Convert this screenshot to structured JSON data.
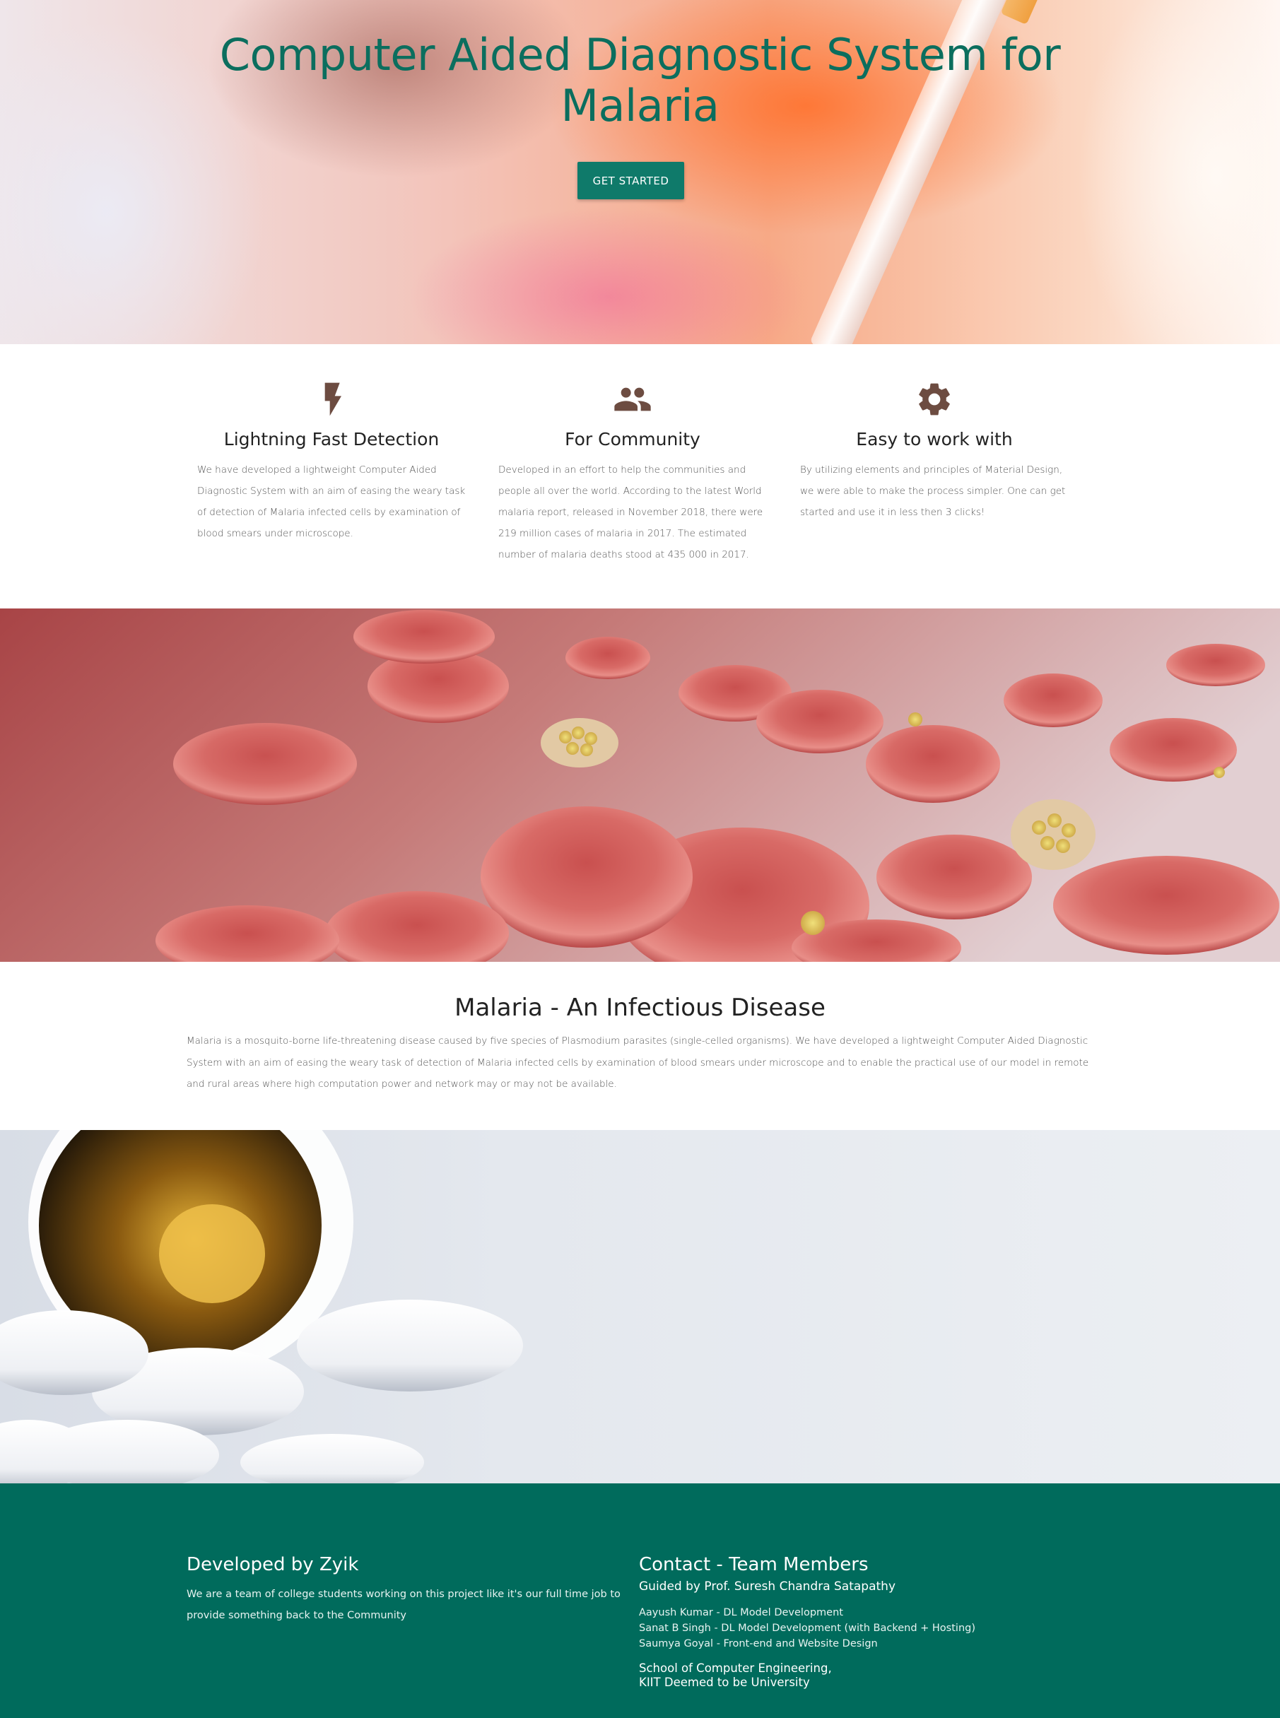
{
  "hero": {
    "title": "Computer Aided Diagnostic System for Malaria",
    "cta_label": "GET STARTED"
  },
  "features": [
    {
      "icon": "lightning-bolt-icon",
      "title": "Lightning Fast Detection",
      "text": "We have developed a lightweight Computer Aided Diagnostic System with an aim of easing the weary task of detection of Malaria infected cells by examination of blood smears under microscope."
    },
    {
      "icon": "people-group-icon",
      "title": "For Community",
      "text": "Developed in an effort to help the communities and people all over the world. According to the latest World malaria report, released in November 2018, there were 219 million cases of malaria in 2017. The estimated number of malaria deaths stood at 435 000 in 2017."
    },
    {
      "icon": "gear-icon",
      "title": "Easy to work with",
      "text": "By utilizing elements and principles of Material Design, we were able to make the process simpler. One can get started and use it in less then 3 clicks!"
    }
  ],
  "about": {
    "title": "Malaria - An Infectious Disease",
    "text": "Malaria is a mosquito-borne life-threatening disease caused by five species of Plasmodium parasites (single-celled organisms). We have developed a lightweight Computer Aided Diagnostic System with an aim of easing the weary task of detection of Malaria infected cells by examination of blood smears under microscope and to enable the practical use of our model in remote and rural areas where high computation power and network may or may not be available."
  },
  "footer": {
    "left_title": "Developed by Zyik",
    "left_text": "We are a team of college students working on this project like it's our full time job to provide something back to the Community",
    "right_title": "Contact - Team Members",
    "guide": "Guided by Prof. Suresh Chandra Satapathy",
    "members": [
      "Aayush Kumar - DL Model Development",
      "Sanat B Singh - DL Model Development (with Backend + Hosting)",
      "Saumya Goyal - Front-end and Website Design"
    ],
    "school_line1": "School of Computer Engineering,",
    "school_line2": "KIIT Deemed to be University"
  },
  "colors": {
    "brand": "#006b5c",
    "title_green": "#0b6e5e",
    "icon_brown": "#6d4c41"
  }
}
